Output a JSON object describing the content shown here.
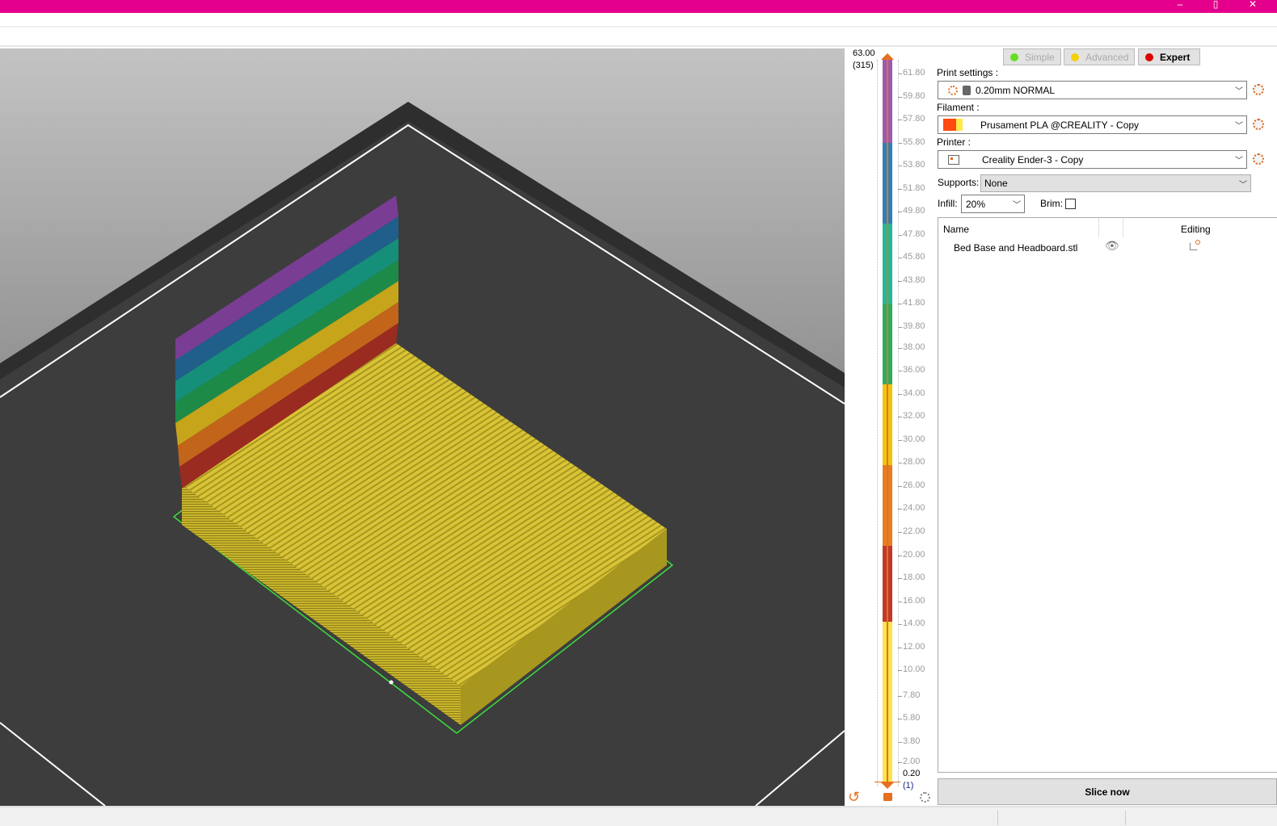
{
  "window": {
    "minimize": "–",
    "maximize": "▯",
    "close": "✕",
    "titlebar_color": "#e4008c"
  },
  "layer_slider": {
    "top_value": "63.00",
    "top_layer": "(315)",
    "bottom_value": "0.20",
    "bottom_layer": "(1)",
    "ticks": [
      "61.80",
      "59.80",
      "57.80",
      "55.80",
      "53.80",
      "51.80",
      "49.80",
      "47.80",
      "45.80",
      "43.80",
      "41.80",
      "39.80",
      "38.00",
      "36.00",
      "34.00",
      "32.00",
      "30.00",
      "28.00",
      "26.00",
      "24.00",
      "22.00",
      "20.00",
      "18.00",
      "16.00",
      "14.00",
      "12.00",
      "10.00",
      "7.80",
      "5.80",
      "3.80",
      "2.00"
    ],
    "color_bands": [
      {
        "from": 55.8,
        "to": 63.0,
        "color": "#9b59b6"
      },
      {
        "from": 48.8,
        "to": 55.8,
        "color": "#2e7fb8"
      },
      {
        "from": 41.8,
        "to": 48.8,
        "color": "#1abc9c"
      },
      {
        "from": 34.8,
        "to": 41.8,
        "color": "#27ae60"
      },
      {
        "from": 27.8,
        "to": 34.8,
        "color": "#f1c40f"
      },
      {
        "from": 20.8,
        "to": 27.8,
        "color": "#e67e22"
      },
      {
        "from": 14.2,
        "to": 20.8,
        "color": "#c0392b"
      },
      {
        "from": 0.2,
        "to": 14.2,
        "color": "#fbe44b"
      }
    ]
  },
  "modes": {
    "simple": "Simple",
    "advanced": "Advanced",
    "expert": "Expert",
    "active": "Expert"
  },
  "settings": {
    "print_label": "Print settings :",
    "print_value": "0.20mm NORMAL",
    "filament_label": "Filament :",
    "filament_value": "Prusament PLA @CREALITY - Copy",
    "printer_label": "Printer :",
    "printer_value": "Creality Ender-3 - Copy",
    "supports_label": "Supports:",
    "supports_value": "None",
    "infill_label": "Infill:",
    "infill_value": "20%",
    "brim_label": "Brim:",
    "brim_checked": false
  },
  "object_list": {
    "col_name": "Name",
    "col_editing": "Editing",
    "items": [
      {
        "name": "Bed Base and Headboard.stl"
      }
    ]
  },
  "slice_button": "Slice now"
}
